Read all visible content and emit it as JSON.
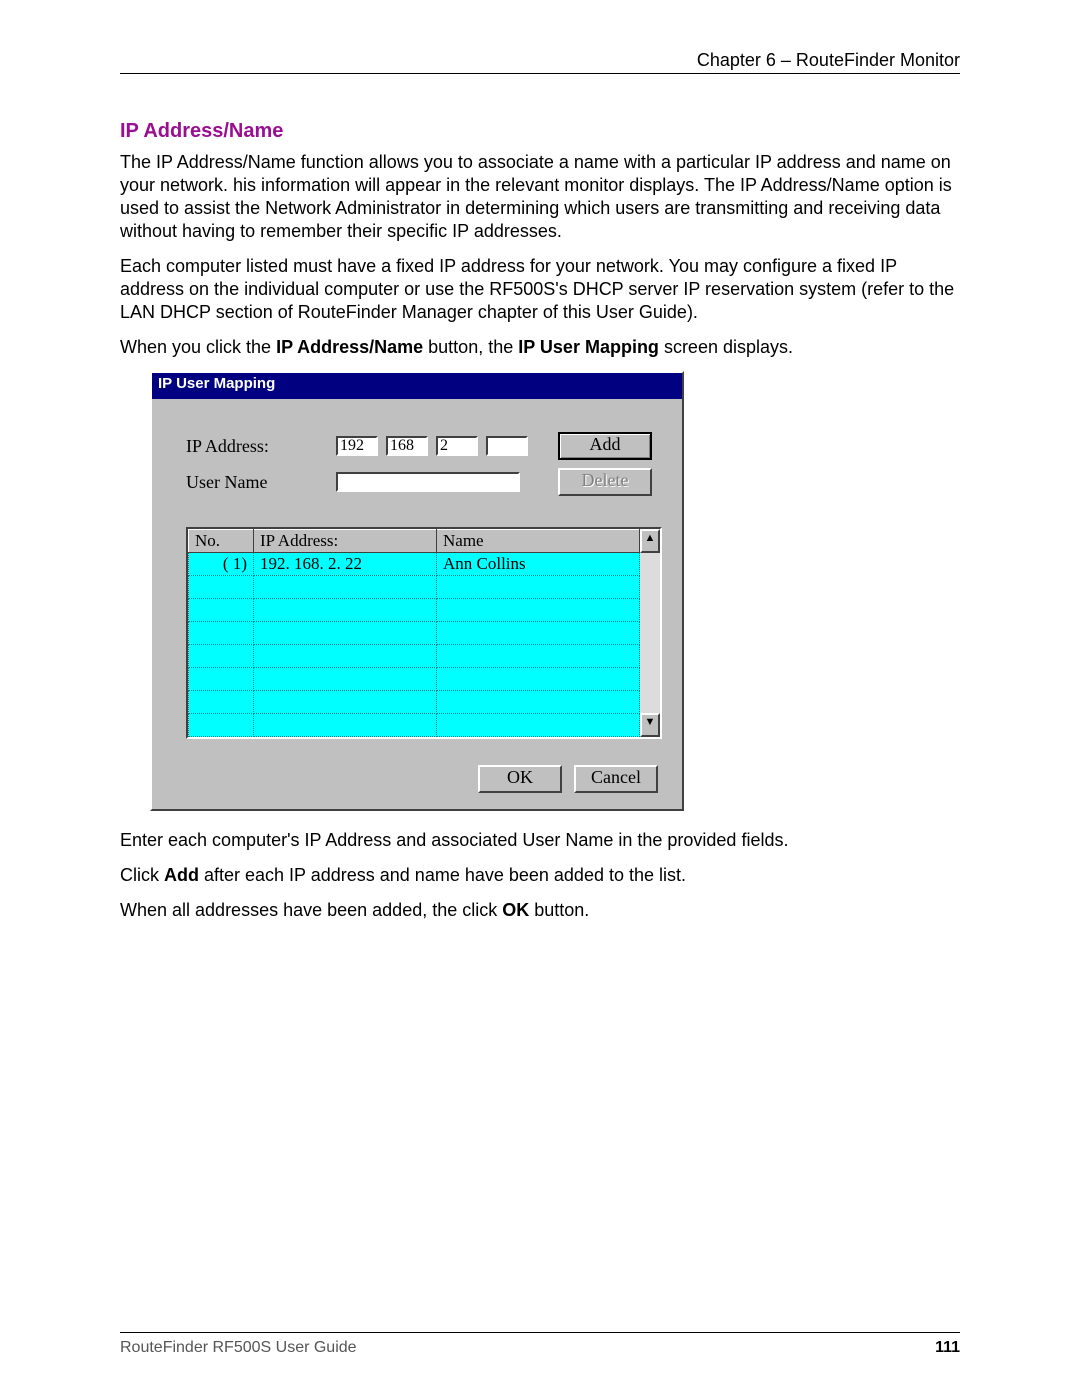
{
  "header": {
    "right": "Chapter 6 – RouteFinder Monitor"
  },
  "section": {
    "title": "IP Address/Name",
    "para1": "The IP Address/Name function allows you to associate a name with a particular IP address and name on your network.  his information will appear in the relevant monitor displays. The IP Address/Name option is used to assist the Network Administrator in determining which users are transmitting and receiving data without having to remember their specific IP addresses.",
    "para2": "Each computer listed must have a fixed IP address for your network. You may configure a fixed IP address on the individual computer or use the RF500S's DHCP server IP reservation system (refer to the LAN DHCP section of RouteFinder Manager chapter of this User Guide).",
    "para3_pre": "When you click the ",
    "para3_b1": "IP Address/Name",
    "para3_mid": " button, the ",
    "para3_b2": "IP User Mapping",
    "para3_post": " screen displays.",
    "after1": "Enter each computer's IP Address and associated User Name in the provided fields.",
    "after2_pre": "Click ",
    "after2_b": "Add",
    "after2_post": " after each IP address and name have been added to the list.",
    "after3_pre": "When all addresses have been added, the click ",
    "after3_b": "OK",
    "after3_post": " button."
  },
  "dialog": {
    "title": "IP User Mapping",
    "labels": {
      "ip": "IP Address:",
      "user": "User Name"
    },
    "ip_octets": [
      "192",
      "168",
      "2",
      ""
    ],
    "user_value": "",
    "buttons": {
      "add": "Add",
      "delete": "Delete",
      "ok": "OK",
      "cancel": "Cancel"
    },
    "columns": {
      "no": "No.",
      "ip": "IP Address:",
      "name": "Name"
    },
    "rows": [
      {
        "no": "( 1)",
        "ip": "192. 168. 2. 22",
        "name": "Ann Collins"
      },
      {
        "no": "",
        "ip": "",
        "name": ""
      },
      {
        "no": "",
        "ip": "",
        "name": ""
      },
      {
        "no": "",
        "ip": "",
        "name": ""
      },
      {
        "no": "",
        "ip": "",
        "name": ""
      },
      {
        "no": "",
        "ip": "",
        "name": ""
      },
      {
        "no": "",
        "ip": "",
        "name": ""
      },
      {
        "no": "",
        "ip": "",
        "name": ""
      }
    ]
  },
  "footer": {
    "left": "RouteFinder RF500S User Guide",
    "page": "111"
  }
}
